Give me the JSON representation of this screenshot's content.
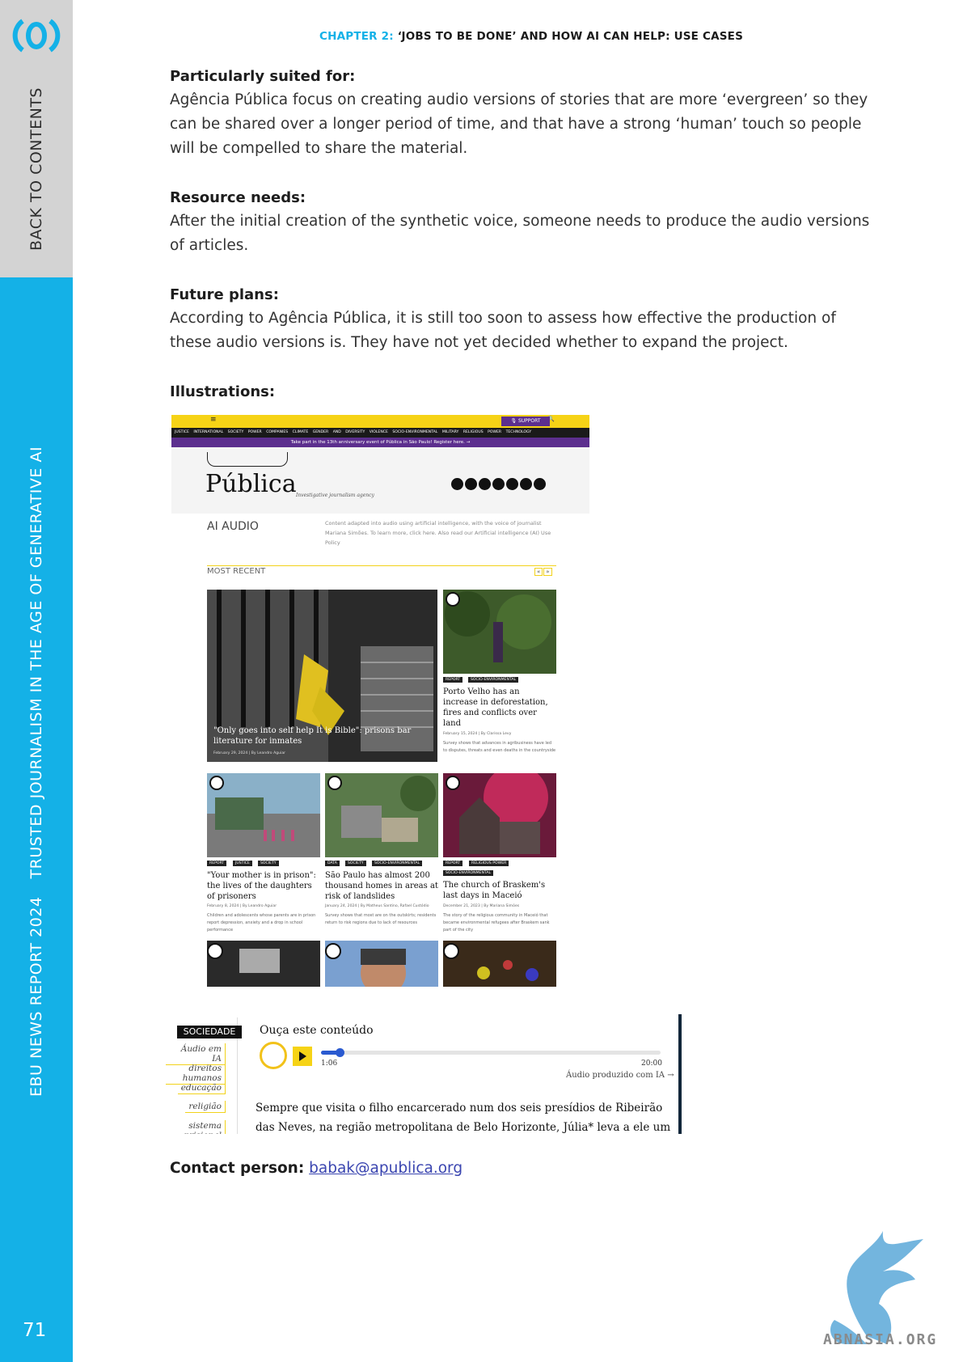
{
  "sidebar": {
    "back_to_contents": "BACK TO CONTENTS",
    "report_a": "EBU NEWS REPORT 2024",
    "report_b": "TRUSTED JOURNALISM IN THE AGE OF GENERATIVE AI",
    "page_number": "71"
  },
  "header": {
    "chapter_label": "CHAPTER 2:",
    "chapter_title": " ‘JOBS TO BE DONE’ AND HOW AI CAN HELP: USE CASES"
  },
  "sections": {
    "suited": {
      "heading": "Particularly suited for:",
      "text": "Agência Pública focus on creating audio versions of stories that are more ‘evergreen’ so they can be shared over a longer period of time, and that have a strong ‘human’ touch so people will be compelled to share the material."
    },
    "resources": {
      "heading": "Resource needs:",
      "text": "After the initial creation of the synthetic voice, someone needs to produce the audio versions of articles."
    },
    "future": {
      "heading": "Future plans:",
      "text": "According to Agência Pública, it is still too soon to assess how effective the production of these audio versions is. They have not yet decided whether to expand the project."
    },
    "illustrations": {
      "heading": "Illustrations:"
    }
  },
  "shot1": {
    "menu_icon": "≡",
    "support": "🎙 SUPPORT",
    "search_icon": "🔍",
    "nav": "JUSTICE INTERNATIONAL SOCIETY POWER COMPANIES CLIMATE GENDER AND DIVERSITY VIOLENCE SOCIO-ENVIRONMENTAL MILITARY RELIGIOUS POWER TECHNOLOGY",
    "banner": "Take part in the 13th anniversary event of Pública in São Paulo! Register here. →",
    "logo": "Pública",
    "tagline": "Investigative journalism agency",
    "ai_audio": "AI AUDIO",
    "ai_desc": "Content adapted into audio using artificial intelligence, with the voice of journalist Mariana Simões. To learn more, click here. Also read our Artificial intelligence (AI) Use Policy",
    "most_recent": "MOST RECENT",
    "arrow_prev": "«",
    "arrow_next": "»",
    "feature": {
      "title": "\"Only goes into self help It is Bible\": prisons bar literature for inmates",
      "meta": "February 29, 2024 | By Leandro Aguiar"
    },
    "porto": {
      "tag1": "REPORT",
      "tag2": "SOCIO-ENVIRONMENTAL",
      "title": "Porto Velho has an increase in deforestation, fires and conflicts over land",
      "meta": "February 15, 2024 | By Clarissa Levy",
      "desc": "Survey shows that advances in agribusiness have led to disputes, threats and even deaths in the countryside"
    },
    "mother": {
      "tag1": "REPORT",
      "tag2": "JUSTICE",
      "tag3": "SOCIETY",
      "title": "\"Your mother is in prison\": the lives of the daughters of prisoners",
      "meta": "February 8, 2024 | By Leandro Aguiar",
      "desc": "Children and adolescents whose parents are in prison report depression, anxiety and a drop in school performance"
    },
    "saopaulo": {
      "tag1": "DATA",
      "tag2": "SOCIETY",
      "tag3": "SOCIO-ENVIRONMENTAL",
      "title": "São Paulo has almost 200 thousand homes in areas at risk of landslides",
      "meta": "January 24, 2024 | By Matheus Santino, Rafael Custódio",
      "desc": "Survey shows that most are on the outskirts; residents return to risk regions due to lack of resources"
    },
    "braskem": {
      "tag1": "REPORT",
      "tag2": "RELIGIOUS POWER",
      "tag3": "SOCIO-ENVIRONMENTAL",
      "title": "The church of Braskem's last days in Maceió",
      "meta": "December 21, 2023 | By Mariana Simões",
      "desc": "The story of the religious community in Maceió that became environmental refugees after Braskem sank part of the city"
    }
  },
  "shot2": {
    "category": "SOCIEDADE",
    "tags": [
      "Áudio em IA",
      "direitos humanos",
      "educação",
      "religião",
      "sistema prisional"
    ],
    "listen": "Ouça este conteúdo",
    "time_elapsed": "1:06",
    "time_total": "20:00",
    "produced": "Áudio produzido com IA →",
    "progress_fraction": 0.055,
    "paragraph": "Sempre que visita o filho encarcerado num dos seis presídios de Ribeirão das Neves, na região metropolitana de Belo Horizonte, Júlia* leva a ele um livro. As"
  },
  "contact": {
    "label": "Contact person:",
    "email": "babak@apublica.org"
  },
  "watermark": "ABNASIA.ORG",
  "colors": {
    "accent_blue": "#14b1e7",
    "pub_yellow": "#f6d316",
    "pub_purple": "#5c2f8e"
  }
}
